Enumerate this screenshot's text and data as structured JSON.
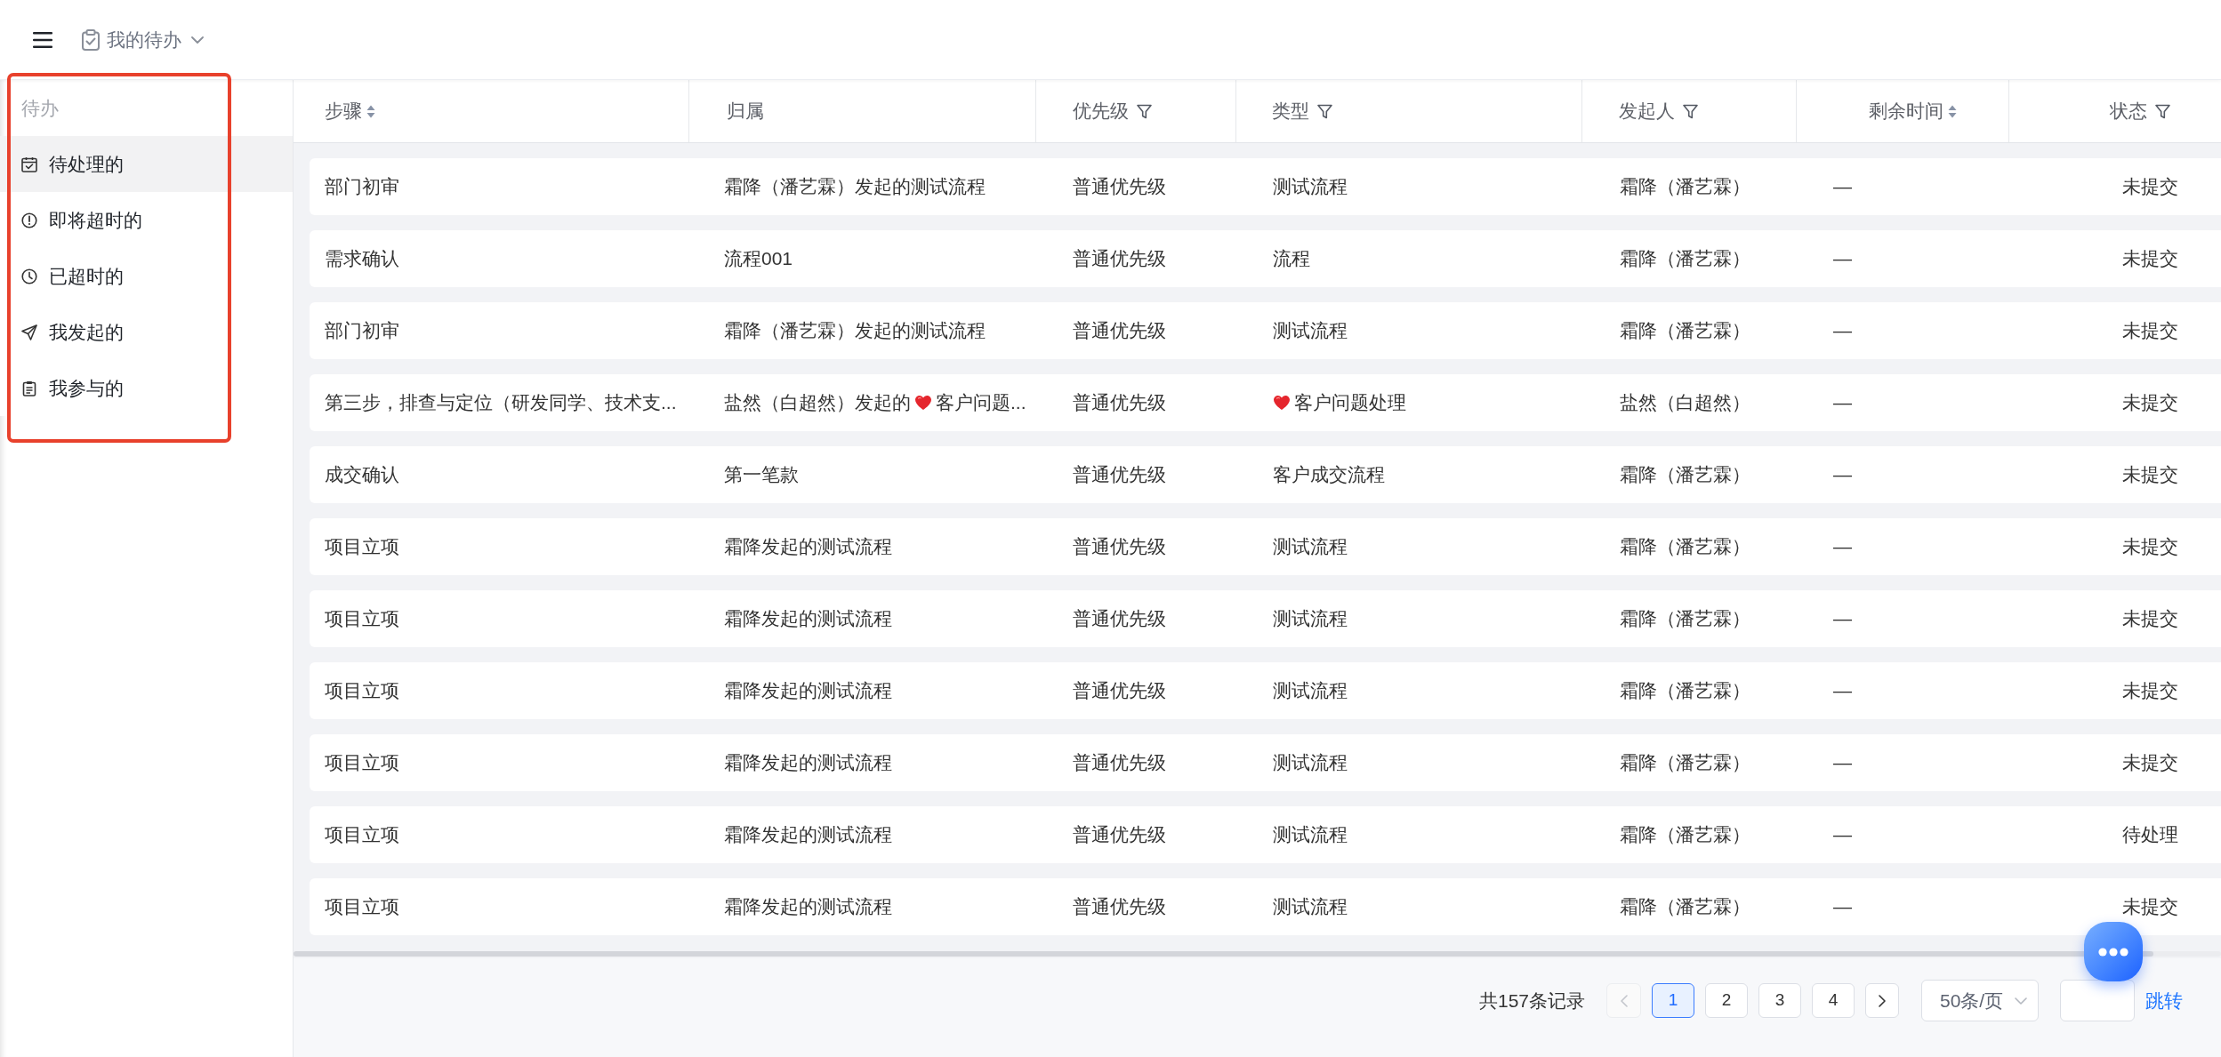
{
  "header": {
    "title": "我的待办"
  },
  "sidebar": {
    "heading": "待办",
    "items": [
      {
        "label": "待处理的",
        "selected": true
      },
      {
        "label": "即将超时的",
        "selected": false
      },
      {
        "label": "已超时的",
        "selected": false
      },
      {
        "label": "我发起的",
        "selected": false
      },
      {
        "label": "我参与的",
        "selected": false
      }
    ]
  },
  "table": {
    "columns": [
      {
        "label": "步骤",
        "sortable": true,
        "filterable": false
      },
      {
        "label": "归属",
        "sortable": false,
        "filterable": false
      },
      {
        "label": "优先级",
        "sortable": false,
        "filterable": true
      },
      {
        "label": "类型",
        "sortable": false,
        "filterable": true
      },
      {
        "label": "发起人",
        "sortable": false,
        "filterable": true
      },
      {
        "label": "剩余时间",
        "sortable": true,
        "filterable": false
      },
      {
        "label": "状态",
        "sortable": false,
        "filterable": true
      }
    ],
    "rows": [
      {
        "cells": [
          "部门初审",
          "霜降（潘艺霖）发起的测试流程",
          "普通优先级",
          "测试流程",
          "霜降（潘艺霖）",
          "—",
          "未提交"
        ]
      },
      {
        "cells": [
          "需求确认",
          "流程001",
          "普通优先级",
          "流程",
          "霜降（潘艺霖）",
          "—",
          "未提交"
        ]
      },
      {
        "cells": [
          "部门初审",
          "霜降（潘艺霖）发起的测试流程",
          "普通优先级",
          "测试流程",
          "霜降（潘艺霖）",
          "—",
          "未提交"
        ]
      },
      {
        "cells": [
          "第三步，排查与定位（研发同学、技术支...",
          [
            {
              "kind": "text",
              "text": "盐然（白超然）发起的"
            },
            {
              "kind": "emoji"
            },
            {
              "kind": "text",
              "text": "客户问题..."
            }
          ],
          "普通优先级",
          [
            {
              "kind": "emoji"
            },
            {
              "kind": "text",
              "text": "客户问题处理"
            }
          ],
          "盐然（白超然）",
          "—",
          "未提交"
        ]
      },
      {
        "cells": [
          "成交确认",
          "第一笔款",
          "普通优先级",
          "客户成交流程",
          "霜降（潘艺霖）",
          "—",
          "未提交"
        ]
      },
      {
        "cells": [
          "项目立项",
          "霜降发起的测试流程",
          "普通优先级",
          "测试流程",
          "霜降（潘艺霖）",
          "—",
          "未提交"
        ]
      },
      {
        "cells": [
          "项目立项",
          "霜降发起的测试流程",
          "普通优先级",
          "测试流程",
          "霜降（潘艺霖）",
          "—",
          "未提交"
        ]
      },
      {
        "cells": [
          "项目立项",
          "霜降发起的测试流程",
          "普通优先级",
          "测试流程",
          "霜降（潘艺霖）",
          "—",
          "未提交"
        ]
      },
      {
        "cells": [
          "项目立项",
          "霜降发起的测试流程",
          "普通优先级",
          "测试流程",
          "霜降（潘艺霖）",
          "—",
          "未提交"
        ]
      },
      {
        "cells": [
          "项目立项",
          "霜降发起的测试流程",
          "普通优先级",
          "测试流程",
          "霜降（潘艺霖）",
          "—",
          "待处理"
        ]
      },
      {
        "cells": [
          "项目立项",
          "霜降发起的测试流程",
          "普通优先级",
          "测试流程",
          "霜降（潘艺霖）",
          "—",
          "未提交"
        ]
      }
    ]
  },
  "pagination": {
    "total": "共157条记录",
    "prev": {
      "disabled": true
    },
    "pages": [
      {
        "label": "1",
        "selected": true
      },
      {
        "label": "2",
        "selected": false
      },
      {
        "label": "3",
        "selected": false
      },
      {
        "label": "4",
        "selected": false
      }
    ],
    "next": {
      "disabled": false
    },
    "page_size": "50条/页",
    "jump": "跳转"
  }
}
